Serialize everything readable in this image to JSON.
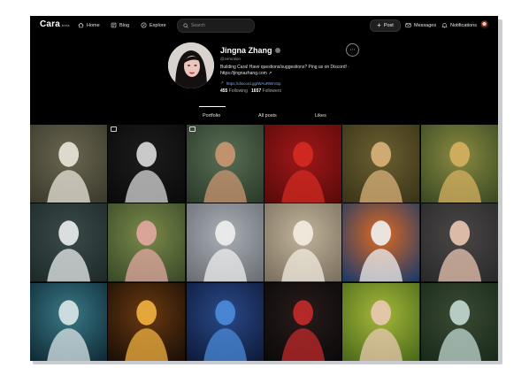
{
  "app": {
    "name": "Cara",
    "badge": "beta"
  },
  "nav": [
    {
      "label": "Home",
      "icon": "home-icon"
    },
    {
      "label": "Blog",
      "icon": "blog-icon"
    },
    {
      "label": "Explore",
      "icon": "explore-icon"
    }
  ],
  "search": {
    "placeholder": "Search"
  },
  "actions": {
    "post": "Post",
    "messages": "Messages",
    "notifications": "Notifications"
  },
  "profile": {
    "name": "Jingna Zhang",
    "handle": "@zemotion",
    "bio": "Building Cara! Have questions/suggestions? Ping us on Discord! · https://jingnazhang.com ↗",
    "link": "https://discord.gg/WAuRWrvSp",
    "followers_count": "455",
    "followers_label": "Following",
    "following_count": "1657",
    "following_label": "Followers",
    "more": "⋯"
  },
  "tabs": [
    {
      "label": "Portfolio",
      "active": true
    },
    {
      "label": "All posts",
      "active": false
    },
    {
      "label": "Likes",
      "active": false
    }
  ],
  "colors": {
    "background": "#000000",
    "link": "#7fa8ff",
    "accent_text": "#ffffff"
  },
  "grid": [
    {
      "name": "woman-in-white-dress-by-window",
      "bg1": "#3b3a2c",
      "bg2": "#6a6650",
      "fig": "#e8e3d8"
    },
    {
      "name": "white-haired-figure-dark",
      "bg1": "#0a0a0a",
      "bg2": "#1d1d1d",
      "fig": "#d8d8d8"
    },
    {
      "name": "redhead-girl-green-dress",
      "bg1": "#2a3a2a",
      "bg2": "#5a6f55",
      "fig": "#c99670"
    },
    {
      "name": "woman-in-red-dress",
      "bg1": "#5a0a0a",
      "bg2": "#a01818",
      "fig": "#d22a22"
    },
    {
      "name": "nude-figure-in-flower-wreath",
      "bg1": "#3a3418",
      "bg2": "#6b6030",
      "fig": "#d8b27a"
    },
    {
      "name": "golden-haired-woman-green",
      "bg1": "#3a4a24",
      "bg2": "#8a8a40",
      "fig": "#d4b060"
    },
    {
      "name": "white-haired-woman-black-collar",
      "bg1": "#1e2a2a",
      "bg2": "#3b4a4a",
      "fig": "#e8ecec"
    },
    {
      "name": "woman-with-black-headdress",
      "bg1": "#3a4a28",
      "bg2": "#7a8a4a",
      "fig": "#e2a7a0"
    },
    {
      "name": "white-sculpted-face",
      "bg1": "#6a6e74",
      "bg2": "#aab0b6",
      "fig": "#eeeeee"
    },
    {
      "name": "woman-white-lace-dress",
      "bg1": "#7a705e",
      "bg2": "#c2b49a",
      "fig": "#f2ece0"
    },
    {
      "name": "woman-in-flower-burst",
      "bg1": "#1a3a6a",
      "bg2": "#e06a20",
      "fig": "#eeeeee"
    },
    {
      "name": "woman-bare-back",
      "bg1": "#2a2a2a",
      "bg2": "#4a4646",
      "fig": "#e8c4b0"
    },
    {
      "name": "figure-underwater-cyan",
      "bg1": "#0e2a36",
      "bg2": "#3a7a86",
      "fig": "#d8e4e6"
    },
    {
      "name": "figure-with-candle-light",
      "bg1": "#1a0e06",
      "bg2": "#6a3a10",
      "fig": "#f0b040"
    },
    {
      "name": "blue-haired-woman",
      "bg1": "#0e1a3a",
      "bg2": "#2a4a8a",
      "fig": "#4a8ad8"
    },
    {
      "name": "dark-woman-with-flowers",
      "bg1": "#0a0a0a",
      "bg2": "#2a1a1a",
      "fig": "#c02a2a"
    },
    {
      "name": "woman-with-braided-hair-green",
      "bg1": "#4a6a1a",
      "bg2": "#a6b83a",
      "fig": "#e8c8b0"
    },
    {
      "name": "mermaid-on-rock-forest",
      "bg1": "#1a2a1a",
      "bg2": "#3a4a34",
      "fig": "#c0d8d0"
    }
  ]
}
